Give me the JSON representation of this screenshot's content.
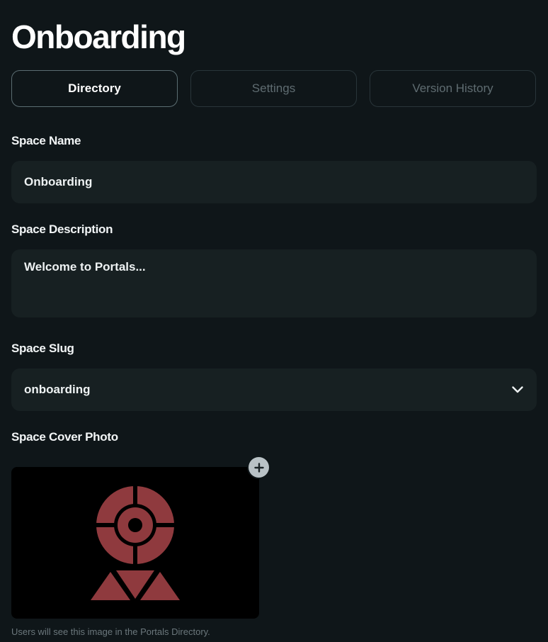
{
  "page": {
    "title": "Onboarding"
  },
  "tabs": [
    {
      "label": "Directory",
      "active": true
    },
    {
      "label": "Settings",
      "active": false
    },
    {
      "label": "Version History",
      "active": false
    }
  ],
  "form": {
    "name_label": "Space Name",
    "name_value": "Onboarding",
    "description_label": "Space Description",
    "description_value": "Welcome to Portals...",
    "slug_label": "Space Slug",
    "slug_value": "onboarding",
    "cover_label": "Space Cover Photo",
    "cover_caption": "Users will see this image in the Portals Directory."
  },
  "icons": {
    "slug_dropdown": "chevron-down-icon",
    "add_cover": "plus-icon",
    "cover_image": "portals-logo"
  },
  "colors": {
    "background": "#0f1619",
    "field_background": "#172022",
    "logo_red": "#8f3a3e",
    "add_button": "#b9c2c6"
  }
}
